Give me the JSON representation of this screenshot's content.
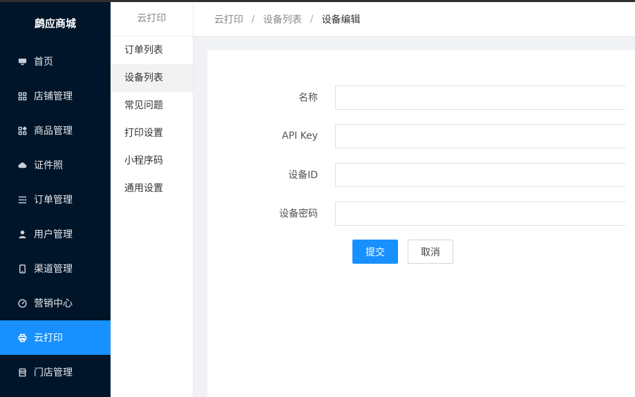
{
  "app": {
    "title": "鹧应商城"
  },
  "sidebar": {
    "items": [
      {
        "label": "首页",
        "icon": "monitor-icon"
      },
      {
        "label": "店铺管理",
        "icon": "grid-icon"
      },
      {
        "label": "商品管理",
        "icon": "apps-icon"
      },
      {
        "label": "证件照",
        "icon": "cloud-icon"
      },
      {
        "label": "订单管理",
        "icon": "list-icon"
      },
      {
        "label": "用户管理",
        "icon": "user-icon"
      },
      {
        "label": "渠道管理",
        "icon": "mobile-icon"
      },
      {
        "label": "营销中心",
        "icon": "dashboard-icon"
      },
      {
        "label": "云打印",
        "icon": "printer-icon",
        "active": true
      },
      {
        "label": "门店管理",
        "icon": "store-icon"
      }
    ]
  },
  "subnav": {
    "title": "云打印",
    "items": [
      {
        "label": "订单列表"
      },
      {
        "label": "设备列表",
        "active": true
      },
      {
        "label": "常见问题"
      },
      {
        "label": "打印设置"
      },
      {
        "label": "小程序码"
      },
      {
        "label": "通用设置"
      }
    ]
  },
  "breadcrumb": {
    "items": [
      "云打印",
      "设备列表",
      "设备编辑"
    ],
    "separator": "/"
  },
  "form": {
    "fields": [
      {
        "label": "名称",
        "value": "",
        "placeholder": ""
      },
      {
        "label": "API Key",
        "value": "",
        "placeholder": ""
      },
      {
        "label": "设备ID",
        "value": "",
        "placeholder": ""
      },
      {
        "label": "设备密码",
        "value": "",
        "placeholder": ""
      }
    ],
    "submit_label": "提交",
    "cancel_label": "取消"
  },
  "colors": {
    "sidebar_bg": "#001529",
    "accent": "#1890ff",
    "page_bg": "#f0f2f5"
  }
}
